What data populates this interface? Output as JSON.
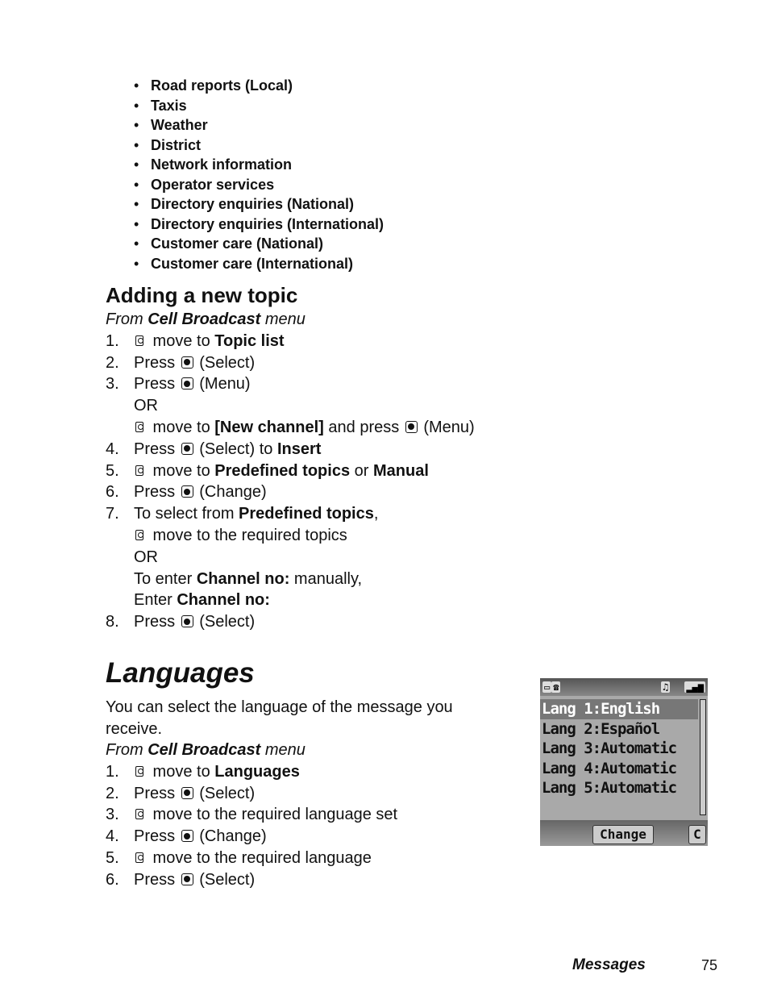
{
  "topic_bullets": [
    "Road reports (Local)",
    "Taxis",
    "Weather",
    "District",
    "Network information",
    "Operator services",
    "Directory enquiries (National)",
    "Directory enquiries (International)",
    "Customer care (National)",
    "Customer care (International)"
  ],
  "adding_topic": {
    "heading": "Adding a new topic",
    "from_prefix": "From ",
    "from_menu": "Cell Broadcast",
    "from_suffix": " menu",
    "steps": {
      "s1": {
        "num": "1.",
        "text": " move to ",
        "bold": "Topic list"
      },
      "s2": {
        "num": "2.",
        "text": "Press ",
        "after": " (Select)"
      },
      "s3": {
        "num": "3.",
        "text": "Press ",
        "after": " (Menu)"
      },
      "s3_or": "OR",
      "s3b": {
        "text": " move to ",
        "bold": "[New channel]",
        "mid": " and press ",
        "after": " (Menu)"
      },
      "s4": {
        "num": "4.",
        "text": "Press ",
        "after": " (Select) to ",
        "bold": "Insert"
      },
      "s5": {
        "num": "5.",
        "text": " move to ",
        "bold": "Predefined topics",
        "mid": " or ",
        "bold2": "Manual"
      },
      "s6": {
        "num": "6.",
        "text": "Press ",
        "after": " (Change)"
      },
      "s7": {
        "num": "7.",
        "text": "To select from ",
        "bold": "Predefined topics",
        "after": ","
      },
      "s7b": " move to the required topics",
      "s7_or": "OR",
      "s7c": {
        "text": "To enter ",
        "bold": "Channel no:",
        "after": " manually,"
      },
      "s7d": {
        "text": "Enter ",
        "bold": "Channel no:"
      },
      "s8": {
        "num": "8.",
        "text": "Press ",
        "after": " (Select)"
      }
    }
  },
  "languages": {
    "heading": "Languages",
    "intro": "You can select the language of the message you receive.",
    "from_prefix": "From ",
    "from_menu": "Cell Broadcast",
    "from_suffix": " menu",
    "steps": {
      "s1": {
        "num": "1.",
        "text": " move to ",
        "bold": "Languages"
      },
      "s2": {
        "num": "2.",
        "text": "Press ",
        "after": " (Select)"
      },
      "s3": {
        "num": "3.",
        "text": " move to the required language set"
      },
      "s4": {
        "num": "4.",
        "text": "Press ",
        "after": " (Change)"
      },
      "s5": {
        "num": "5.",
        "text": " move to the required language"
      },
      "s6": {
        "num": "6.",
        "text": "Press ",
        "after": " (Select)"
      }
    }
  },
  "phone_screen": {
    "items": [
      "Lang 1:English",
      "Lang 2:Español",
      "Lang 3:Automatic",
      "Lang 4:Automatic",
      "Lang 5:Automatic"
    ],
    "selected_index": 0,
    "softkey_center": "Change",
    "softkey_right": "C"
  },
  "footer": {
    "section": "Messages",
    "page": "75"
  }
}
